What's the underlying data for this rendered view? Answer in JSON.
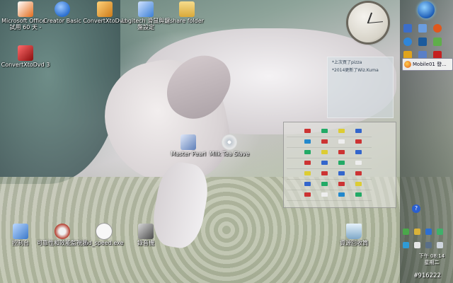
{
  "desktop": {
    "icons": [
      {
        "name": "microsoft-office-icon",
        "label": "Microsoft Office - 試用 60 天 -",
        "color": "#e46c1b"
      },
      {
        "name": "creator-basic-icon",
        "label": "Creator Basic",
        "color": "#2b6fcf"
      },
      {
        "name": "convertxtodvd-icon",
        "label": "ConvertXtoDvd",
        "color": "#cc7a18"
      },
      {
        "name": "logitech-icon",
        "label": "Logitech 滑鼠與鍵盤設定",
        "color": "#3b7fd4"
      },
      {
        "name": "share-folder-icon",
        "label": "share folder",
        "color": "#e7c05b"
      },
      {
        "name": "convertxtodvd3-icon",
        "label": "ConvertXtoDvd 3",
        "color": "#c62020"
      },
      {
        "name": "master-pearl-icon",
        "label": "Master Pearl",
        "color": "#5f7fb8"
      },
      {
        "name": "milk-tea-slave-icon",
        "label": "Milk Tea Slave",
        "color": "#d0d0d0"
      },
      {
        "name": "control-panel-icon",
        "label": "控制台",
        "color": "#3a78c9"
      },
      {
        "name": "performance-icon",
        "label": "可靠性和效能監視器",
        "color": "#b43a2a"
      },
      {
        "name": "hd-speed-icon",
        "label": "hd_speed.exe",
        "color": "#f2f2f2"
      },
      {
        "name": "recorder-icon",
        "label": "錄音機",
        "color": "#4a4a4a"
      },
      {
        "name": "recycle-bin-icon",
        "label": "資源回收筒",
        "color": "#7fa8c8"
      }
    ]
  },
  "gadgets": {
    "note_lines": [
      "*上次買了pizza",
      "*2014更新了Wiz.Kuma"
    ],
    "matrix_rows": [
      [
        "",
        "",
        "",
        "",
        ""
      ],
      [
        "",
        "",
        "",
        "",
        ""
      ],
      [
        "",
        "",
        "",
        "",
        ""
      ],
      [
        "",
        "",
        "",
        "",
        ""
      ],
      [
        "",
        "",
        "",
        "",
        ""
      ],
      [
        "",
        "",
        "",
        "",
        ""
      ],
      [
        "",
        "",
        "",
        "",
        ""
      ]
    ]
  },
  "taskbar": {
    "task_button_label": "Mobile01 發...",
    "time": "下午 08:14",
    "day": "星期二",
    "help_glyph": "?"
  },
  "watermark": "#916222",
  "colors": {
    "accent": "#1f5fb8",
    "sidebar": "#2a3535"
  }
}
